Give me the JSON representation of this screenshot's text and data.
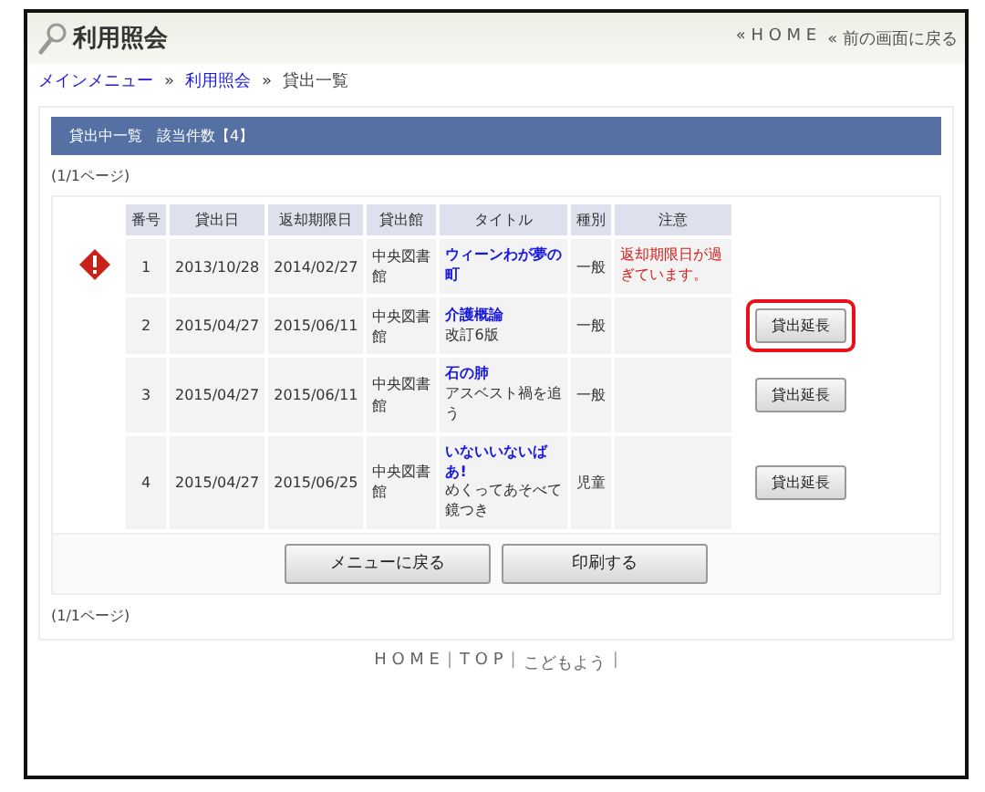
{
  "header": {
    "title": "利用照会",
    "links": [
      "« H O M E",
      "« 前の画面に戻る"
    ]
  },
  "breadcrumb": [
    {
      "label": "メインメニュー",
      "link": true
    },
    {
      "label": "»",
      "link": false
    },
    {
      "label": "利用照会",
      "link": true
    },
    {
      "label": "»",
      "link": false
    },
    {
      "label": "貸出一覧",
      "link": false
    }
  ],
  "panel": {
    "heading": "貸出中一覧　該当件数【4】",
    "page_top": "(1/1ページ)",
    "page_bottom": "(1/1ページ)"
  },
  "table": {
    "columns": [
      "番号",
      "貸出日",
      "返却期限日",
      "貸出館",
      "タイトル",
      "種別",
      "注意"
    ],
    "rows": [
      {
        "warning": true,
        "no": "1",
        "lent": "2013/10/28",
        "due": "2014/02/27",
        "library": "中央図書館",
        "title": "ウィーンわが夢の町",
        "subtitle": null,
        "type": "一般",
        "note": "返却期限日が過ぎています。",
        "button": null,
        "highlighted": false
      },
      {
        "warning": false,
        "no": "2",
        "lent": "2015/04/27",
        "due": "2015/06/11",
        "library": "中央図書館",
        "title": "介護概論",
        "subtitle": "改訂6版",
        "type": "一般",
        "note": null,
        "button": "貸出延長",
        "highlighted": true
      },
      {
        "warning": false,
        "no": "3",
        "lent": "2015/04/27",
        "due": "2015/06/11",
        "library": "中央図書館",
        "title": "石の肺",
        "subtitle": "アスベスト禍を追う",
        "type": "一般",
        "note": null,
        "button": "貸出延長",
        "highlighted": false
      },
      {
        "warning": false,
        "no": "4",
        "lent": "2015/04/27",
        "due": "2015/06/25",
        "library": "中央図書館",
        "title": "いないいないばあ!",
        "subtitle": "めくってあそべて鏡つき",
        "type": "児童",
        "note": null,
        "button": "貸出延長",
        "highlighted": false
      }
    ]
  },
  "actions": [
    "メニューに戻る",
    "印刷する"
  ],
  "footer": [
    "H O M E",
    "|",
    "T O P",
    "|",
    "こどもよう",
    "|"
  ]
}
